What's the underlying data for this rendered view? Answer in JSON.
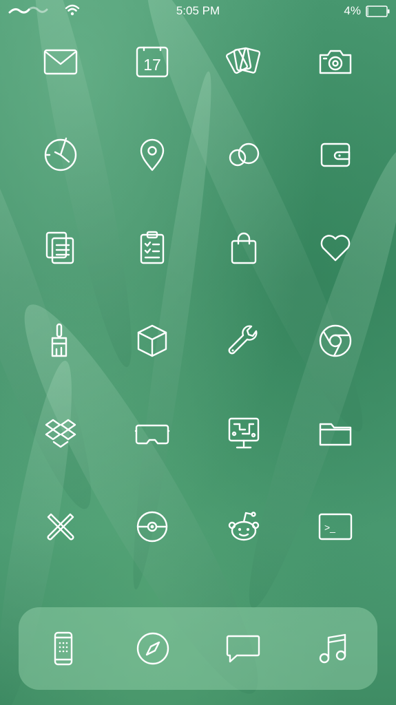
{
  "status_bar": {
    "time": "5:05 PM",
    "battery_percent": "4%",
    "battery_level": 0.04,
    "icons": [
      "signal-icon",
      "wifi-icon",
      "battery-icon"
    ]
  },
  "home_screen": {
    "apps": [
      {
        "icon": "mail-icon"
      },
      {
        "icon": "calendar-icon",
        "text": "17"
      },
      {
        "icon": "cards-icon"
      },
      {
        "icon": "camera-icon"
      },
      {
        "icon": "clock-icon"
      },
      {
        "icon": "maps-icon"
      },
      {
        "icon": "game-center-icon"
      },
      {
        "icon": "wallet-icon"
      },
      {
        "icon": "documents-icon"
      },
      {
        "icon": "clipboard-icon"
      },
      {
        "icon": "shopping-bag-icon"
      },
      {
        "icon": "heart-icon"
      },
      {
        "icon": "paintbrush-icon"
      },
      {
        "icon": "package-icon"
      },
      {
        "icon": "wrench-icon"
      },
      {
        "icon": "chrome-icon"
      },
      {
        "icon": "dropbox-icon"
      },
      {
        "icon": "vr-headset-icon"
      },
      {
        "icon": "circuit-monitor-icon"
      },
      {
        "icon": "folder-icon"
      },
      {
        "icon": "cross-tools-icon"
      },
      {
        "icon": "pokeball-icon"
      },
      {
        "icon": "reddit-icon"
      },
      {
        "icon": "terminal-icon",
        "text": ">_"
      }
    ]
  },
  "dock": {
    "apps": [
      {
        "icon": "phone-icon"
      },
      {
        "icon": "safari-icon"
      },
      {
        "icon": "messages-icon"
      },
      {
        "icon": "music-icon"
      }
    ]
  },
  "colors": {
    "wallpaper": "#4a9a72",
    "icon_stroke": "#ffffff",
    "dock_background": "#a9dfbe"
  }
}
